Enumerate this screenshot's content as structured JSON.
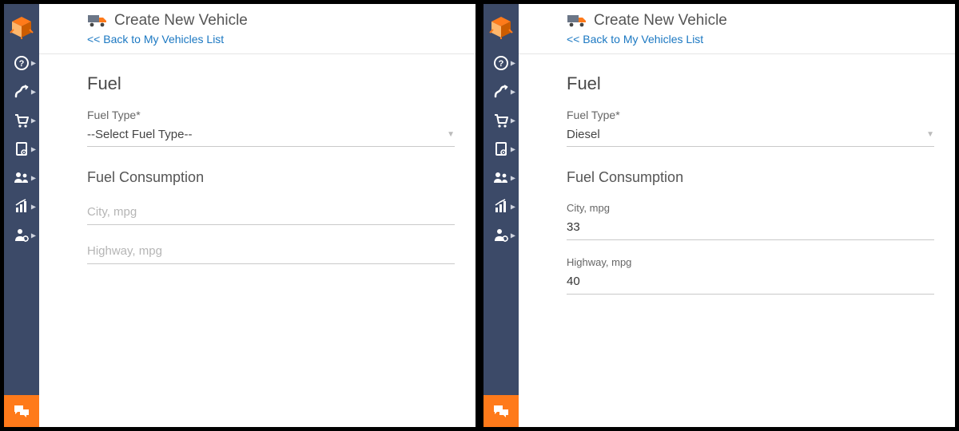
{
  "left": {
    "header": {
      "title": "Create New Vehicle",
      "back_link": "<< Back to My Vehicles List"
    },
    "form": {
      "fuel_heading": "Fuel",
      "fuel_type_label": "Fuel Type*",
      "fuel_type_value": "--Select Fuel Type--",
      "consumption_heading": "Fuel Consumption",
      "city_label": "",
      "city_placeholder": "City, mpg",
      "city_value": "",
      "highway_label": "",
      "highway_placeholder": "Highway, mpg",
      "highway_value": ""
    }
  },
  "right": {
    "header": {
      "title": "Create New Vehicle",
      "back_link": "<< Back to My Vehicles List"
    },
    "form": {
      "fuel_heading": "Fuel",
      "fuel_type_label": "Fuel Type*",
      "fuel_type_value": "Diesel",
      "consumption_heading": "Fuel Consumption",
      "city_label": "City, mpg",
      "city_placeholder": "City, mpg",
      "city_value": "33",
      "highway_label": "Highway, mpg",
      "highway_placeholder": "Highway, mpg",
      "highway_value": "40"
    }
  },
  "sidebar": {
    "items": [
      {
        "name": "help-icon"
      },
      {
        "name": "routes-icon"
      },
      {
        "name": "cart-icon"
      },
      {
        "name": "address-book-icon"
      },
      {
        "name": "team-icon"
      },
      {
        "name": "analytics-icon"
      },
      {
        "name": "user-settings-icon"
      }
    ]
  }
}
